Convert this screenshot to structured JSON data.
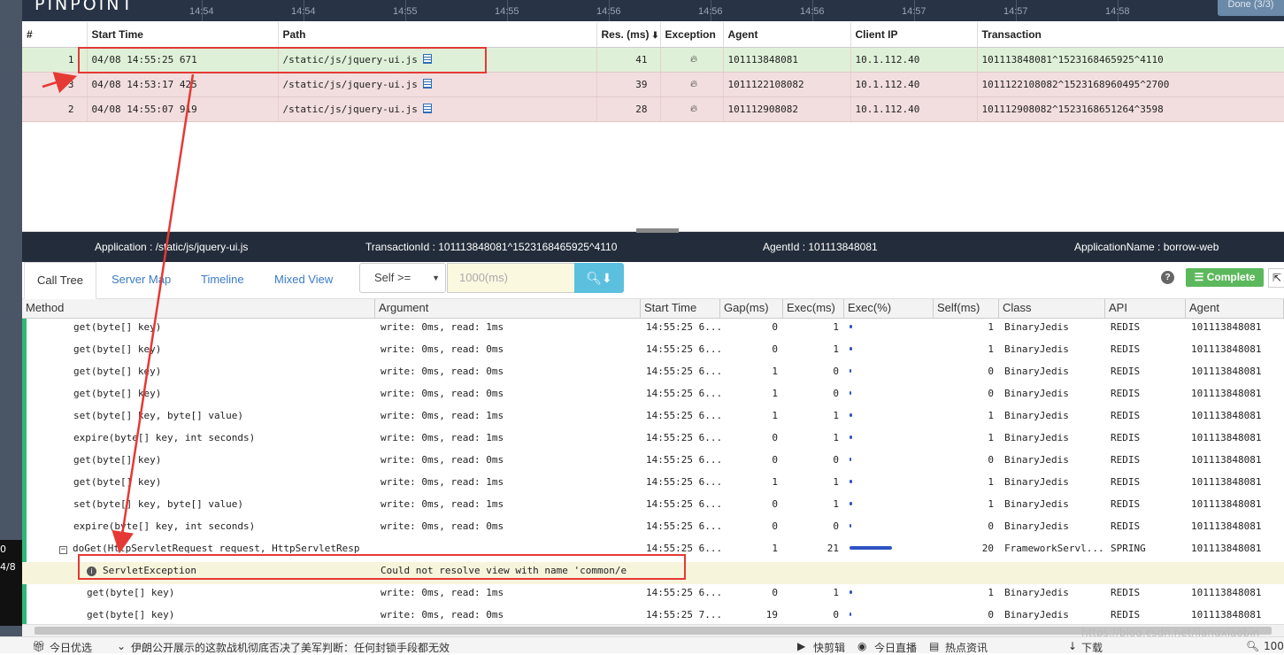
{
  "app": {
    "logo": "PINPOINT",
    "done_button": "Done (3/3)"
  },
  "timeline_ticks": [
    "14:54",
    "14:54",
    "14:55",
    "14:55",
    "14:56",
    "14:56",
    "14:56",
    "14:57",
    "14:57",
    "14:58"
  ],
  "left_sidebar": {
    "line1": "0",
    "line2": "4/8"
  },
  "tx_table": {
    "headers": [
      "#",
      "Start Time",
      "Path",
      "Res. (ms)",
      "Exception",
      "Agent",
      "Client IP",
      "Transaction"
    ],
    "sort_icon": "sort-desc-icon",
    "rows": [
      {
        "num": "1",
        "start": "04/08 14:55:25 671",
        "path": "/static/js/jquery-ui.js",
        "res": "41",
        "agent": "101113848081",
        "ip": "10.1.112.40",
        "tx": "101113848081^1523168465925^4110",
        "state": "selected"
      },
      {
        "num": "3",
        "start": "04/08 14:53:17 425",
        "path": "/static/js/jquery-ui.js",
        "res": "39",
        "agent": "1011122108082",
        "ip": "10.1.112.40",
        "tx": "1011122108082^1523168960495^2700",
        "state": "error"
      },
      {
        "num": "2",
        "start": "04/08 14:55:07 919",
        "path": "/static/js/jquery-ui.js",
        "res": "28",
        "agent": "101112908082",
        "ip": "10.1.112.40",
        "tx": "101112908082^1523168651264^3598",
        "state": "error"
      }
    ]
  },
  "info_bar": {
    "application": "Application : /static/js/jquery-ui.js",
    "transaction_id": "TransactionId : 101113848081^1523168465925^4110",
    "agent_id": "AgentId : 101113848081",
    "application_name": "ApplicationName : borrow-web"
  },
  "tabs": {
    "call_tree": "Call Tree",
    "server_map": "Server Map",
    "timeline": "Timeline",
    "mixed_view": "Mixed View"
  },
  "filter": {
    "select_value": "Self >=",
    "input_placeholder": "1000(ms)",
    "complete_label": "Complete",
    "help": "?"
  },
  "grid": {
    "headers": [
      "Method",
      "Argument",
      "Start Time",
      "Gap(ms)",
      "Exec(ms)",
      "Exec(%)",
      "Self(ms)",
      "Class",
      "API",
      "Agent"
    ],
    "rows": [
      {
        "method": "get(byte[] key)",
        "arg": "write: 0ms, read: 1ms",
        "start": "14:55:25 6...",
        "gap": "0",
        "exec": "1",
        "pct": 3,
        "self": "1",
        "cls": "BinaryJedis",
        "api": "REDIS",
        "agent": "101113848081",
        "indent": 1
      },
      {
        "method": "get(byte[] key)",
        "arg": "write: 0ms, read: 0ms",
        "start": "14:55:25 6...",
        "gap": "0",
        "exec": "1",
        "pct": 3,
        "self": "1",
        "cls": "BinaryJedis",
        "api": "REDIS",
        "agent": "101113848081",
        "indent": 1
      },
      {
        "method": "get(byte[] key)",
        "arg": "write: 0ms, read: 0ms",
        "start": "14:55:25 6...",
        "gap": "1",
        "exec": "0",
        "pct": 1,
        "self": "0",
        "cls": "BinaryJedis",
        "api": "REDIS",
        "agent": "101113848081",
        "indent": 1
      },
      {
        "method": "get(byte[] key)",
        "arg": "write: 0ms, read: 0ms",
        "start": "14:55:25 6...",
        "gap": "1",
        "exec": "0",
        "pct": 1,
        "self": "0",
        "cls": "BinaryJedis",
        "api": "REDIS",
        "agent": "101113848081",
        "indent": 1
      },
      {
        "method": "set(byte[] key, byte[] value)",
        "arg": "write: 0ms, read: 1ms",
        "start": "14:55:25 6...",
        "gap": "1",
        "exec": "1",
        "pct": 3,
        "self": "1",
        "cls": "BinaryJedis",
        "api": "REDIS",
        "agent": "101113848081",
        "indent": 1
      },
      {
        "method": "expire(byte[] key, int seconds)",
        "arg": "write: 0ms, read: 1ms",
        "start": "14:55:25 6...",
        "gap": "0",
        "exec": "1",
        "pct": 3,
        "self": "1",
        "cls": "BinaryJedis",
        "api": "REDIS",
        "agent": "101113848081",
        "indent": 1
      },
      {
        "method": "get(byte[] key)",
        "arg": "write: 0ms, read: 0ms",
        "start": "14:55:25 6...",
        "gap": "0",
        "exec": "0",
        "pct": 1,
        "self": "0",
        "cls": "BinaryJedis",
        "api": "REDIS",
        "agent": "101113848081",
        "indent": 1
      },
      {
        "method": "get(byte[] key)",
        "arg": "write: 0ms, read: 1ms",
        "start": "14:55:25 6...",
        "gap": "1",
        "exec": "1",
        "pct": 3,
        "self": "1",
        "cls": "BinaryJedis",
        "api": "REDIS",
        "agent": "101113848081",
        "indent": 1
      },
      {
        "method": "set(byte[] key, byte[] value)",
        "arg": "write: 0ms, read: 1ms",
        "start": "14:55:25 6...",
        "gap": "0",
        "exec": "1",
        "pct": 3,
        "self": "1",
        "cls": "BinaryJedis",
        "api": "REDIS",
        "agent": "101113848081",
        "indent": 1
      },
      {
        "method": "expire(byte[] key, int seconds)",
        "arg": "write: 0ms, read: 0ms",
        "start": "14:55:25 6...",
        "gap": "0",
        "exec": "0",
        "pct": 1,
        "self": "0",
        "cls": "BinaryJedis",
        "api": "REDIS",
        "agent": "101113848081",
        "indent": 1
      },
      {
        "method": "doGet(HttpServletRequest request, HttpServletResp",
        "arg": "",
        "start": "14:55:25 6...",
        "gap": "1",
        "exec": "21",
        "pct": 48,
        "self": "20",
        "cls": "FrameworkServl...",
        "api": "SPRING",
        "agent": "101113848081",
        "indent": 1,
        "toggle": "⊟"
      },
      {
        "method": "ServletException",
        "arg": "Could not resolve view with name 'common/e",
        "start": "",
        "gap": "",
        "exec": "",
        "pct": 0,
        "self": "",
        "cls": "",
        "api": "",
        "agent": "",
        "indent": 2,
        "exception": true
      },
      {
        "method": "get(byte[] key)",
        "arg": "write: 0ms, read: 1ms",
        "start": "14:55:25 6...",
        "gap": "0",
        "exec": "1",
        "pct": 3,
        "self": "1",
        "cls": "BinaryJedis",
        "api": "REDIS",
        "agent": "101113848081",
        "indent": 2
      },
      {
        "method": "get(byte[] key)",
        "arg": "write: 0ms, read: 0ms",
        "start": "14:55:25 7...",
        "gap": "19",
        "exec": "0",
        "pct": 1,
        "self": "0",
        "cls": "BinaryJedis",
        "api": "REDIS",
        "agent": "101113848081",
        "indent": 2
      }
    ]
  },
  "taskbar": {
    "item1": "今日优选",
    "news": "伊朗公开展示的这款战机彻底否决了美军判断：任何封锁手段都无效",
    "clip": "快剪辑",
    "live": "今日直播",
    "hot": "热点资讯",
    "download": "下载",
    "zoom": "100"
  },
  "watermark": "https://blog.csdn.net/jiangxiaobin"
}
